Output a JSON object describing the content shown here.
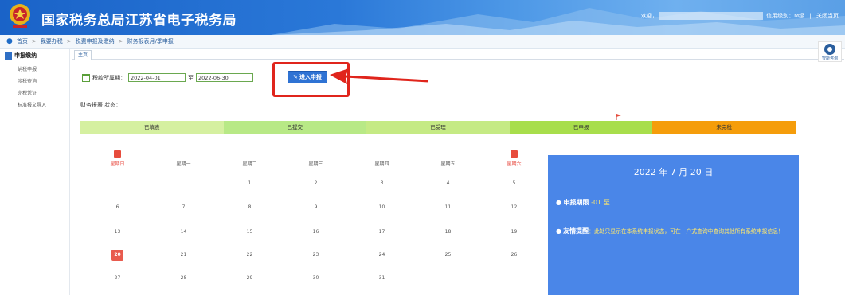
{
  "header": {
    "title": "国家税务总局江苏省电子税务局",
    "welcome": "欢迎，",
    "credit_level": "信用级别：M级",
    "close_label": "关闭当页",
    "separator": "|"
  },
  "breadcrumb": [
    "首页",
    "我要办税",
    "税费申报及缴纳",
    "财务报表月/季申报"
  ],
  "breadcrumb_sep": ">",
  "sidebar": {
    "title": "申报缴纳",
    "items": [
      "纳税申报",
      "涉税查询",
      "完税凭证",
      "标准报文导入"
    ]
  },
  "tabs": {
    "home": "主页"
  },
  "help": {
    "label": "智能咨询"
  },
  "period": {
    "label": "税款所属期：",
    "start": "2022-04-01",
    "to": "至",
    "end": "2022-06-30"
  },
  "enter_button": {
    "label": "进入申报"
  },
  "status": {
    "label": "财务报表 状态："
  },
  "legend": [
    {
      "label": "已填表",
      "color": "#d5f0a0"
    },
    {
      "label": "已提交",
      "color": "#b8e986"
    },
    {
      "label": "已受理",
      "color": "#c5ea84"
    },
    {
      "label": "已申报",
      "color": "#a8de4c"
    },
    {
      "label": "未完税",
      "color": "#f59d0b"
    }
  ],
  "calendar": {
    "weekdays": [
      "星期日",
      "星期一",
      "星期二",
      "星期三",
      "星期四",
      "星期五",
      "星期六"
    ],
    "weekend_color": "#e8493f",
    "weeks": [
      [
        "",
        "",
        "1",
        "2",
        "3",
        "4",
        "5"
      ],
      [
        "6",
        "7",
        "8",
        "9",
        "10",
        "11",
        "12"
      ],
      [
        "13",
        "14",
        "15",
        "16",
        "17",
        "18",
        "19"
      ],
      [
        "20",
        "21",
        "22",
        "23",
        "24",
        "25",
        "26"
      ],
      [
        "27",
        "28",
        "29",
        "30",
        "31",
        "",
        ""
      ]
    ],
    "today": "20"
  },
  "info": {
    "date": "2022 年 7 月 20 日",
    "deadline_label": "申报期限",
    "deadline_value": "-01  至",
    "tip_label": "友情提醒",
    "tip_text": "：此处只显示在本系统申报状态，可在一户式查询中查询其他所有系统申报信息！",
    "bullet": "●"
  }
}
